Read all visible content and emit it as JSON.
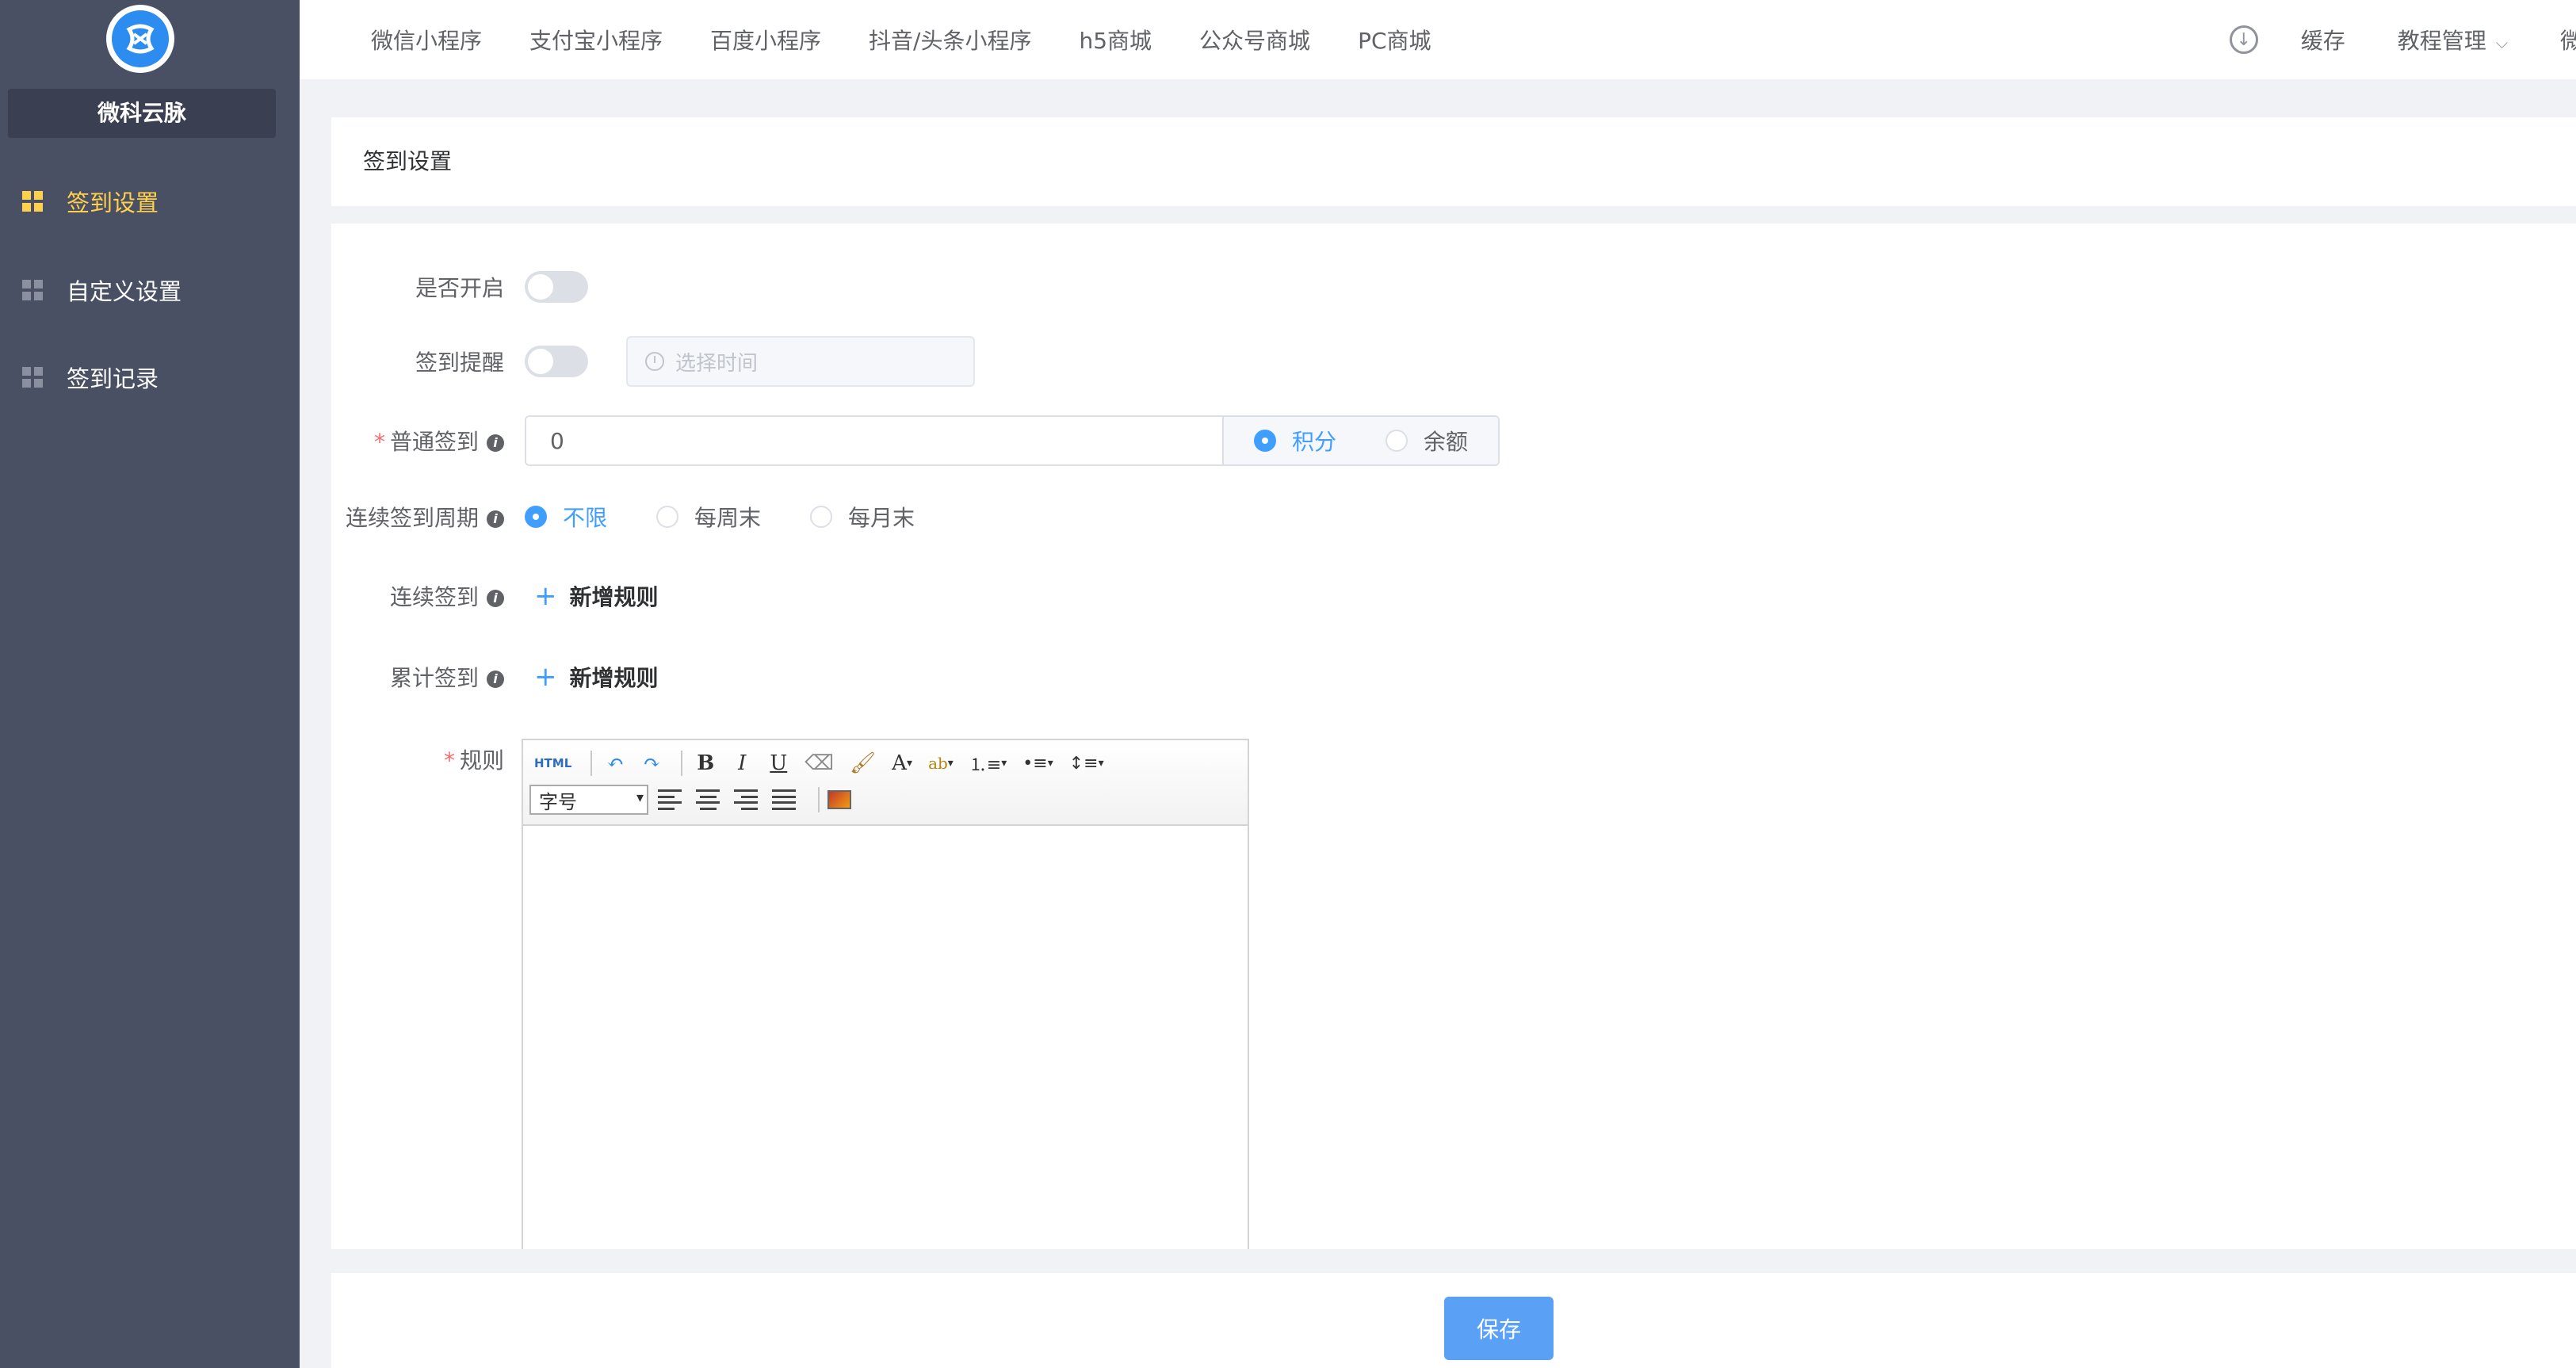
{
  "sidebar": {
    "brand": "微科云脉",
    "items": [
      {
        "label": "签到设置",
        "active": true
      },
      {
        "label": "自定义设置",
        "active": false
      },
      {
        "label": "签到记录",
        "active": false
      }
    ]
  },
  "topnav": {
    "items": [
      "微信小程序",
      "支付宝小程序",
      "百度小程序",
      "抖音/头条小程序",
      "h5商城",
      "公众号商城",
      "PC商城"
    ],
    "cache": "缓存",
    "tutorial": "教程管理",
    "cutoff": "微"
  },
  "page": {
    "title": "签到设置"
  },
  "form": {
    "enable_label": "是否开启",
    "remind_label": "签到提醒",
    "time_placeholder": "选择时间",
    "normal_label": "普通签到",
    "normal_value": "0",
    "reward_options": [
      "积分",
      "余额"
    ],
    "cycle_label": "连续签到周期",
    "cycle_options": [
      "不限",
      "每周末",
      "每月末"
    ],
    "continuous_label": "连续签到",
    "cumulative_label": "累计签到",
    "add_rule": "新增规则",
    "rule_label": "规则",
    "required_mark": "*",
    "info_mark": "i"
  },
  "editor": {
    "html_btn": "HTML",
    "font_size_placeholder": "字号"
  },
  "footer": {
    "save": "保存"
  },
  "colors": {
    "sidebar": "#4a5064",
    "active": "#ffd04b",
    "primary": "#409eff",
    "save": "#5aa0f5"
  }
}
